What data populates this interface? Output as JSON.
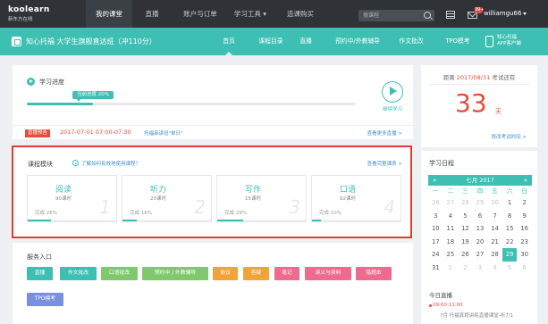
{
  "brand": {
    "name": "koolearn",
    "subtitle": "新东方在线"
  },
  "topnav": [
    {
      "label": "我的课堂",
      "active": true
    },
    {
      "label": "直播",
      "active": false
    },
    {
      "label": "账户与订单",
      "active": false
    },
    {
      "label": "学习工具 ▾",
      "active": false
    },
    {
      "label": "选课购买",
      "active": false
    }
  ],
  "search": {
    "placeholder": "搜课程"
  },
  "notifications": {
    "count": "99+"
  },
  "user": {
    "name": "williamgu66"
  },
  "course": {
    "title": "知心托福 大学生旗舰直达班（冲110分）"
  },
  "subnav": [
    {
      "label": "首页",
      "active": true
    },
    {
      "label": "课程目录",
      "active": false
    },
    {
      "label": "直播",
      "active": false
    },
    {
      "label": "预约中/外教辅导",
      "active": false
    },
    {
      "label": "作文批改",
      "active": false
    },
    {
      "label": "TPO模考",
      "active": false
    }
  ],
  "app": {
    "line1": "知心托福",
    "line2": "APP客户端"
  },
  "progress": {
    "title": "学习进度",
    "tag": "当前进度 20%",
    "percent": 20,
    "continue_label": "继续学习"
  },
  "live": {
    "badge": "直播预告",
    "time": "2017-07-01 07:00-07:30",
    "desc": "托福串讲班\"单日\"",
    "more": "查看更多直播 >"
  },
  "modules": {
    "title": "课程模块",
    "help": "了解如何有效地使用课程？",
    "more": "查看完整课表 >",
    "items": [
      {
        "name": "阅读",
        "hours": "90课时",
        "done": "完成 26%",
        "percent": 26,
        "num": "1"
      },
      {
        "name": "听力",
        "hours": "20课时",
        "done": "完成 16%",
        "percent": 16,
        "num": "2"
      },
      {
        "name": "写作",
        "hours": "15课时",
        "done": "完成 29%",
        "percent": 29,
        "num": "3"
      },
      {
        "name": "口语",
        "hours": "92课时",
        "done": "完成 10%",
        "percent": 10,
        "num": "4"
      }
    ]
  },
  "services": {
    "title": "服务入口",
    "items": [
      {
        "label": "直播",
        "color": "#3dbfb3"
      },
      {
        "label": "作文批改",
        "color": "#3dbfb3"
      },
      {
        "label": "口语批改",
        "color": "#7ec96b"
      },
      {
        "label": "预约中 / 外教辅导",
        "color": "#7ec96b"
      },
      {
        "label": "协议",
        "color": "#f3a23a"
      },
      {
        "label": "答疑",
        "color": "#f3a23a"
      },
      {
        "label": "笔记",
        "color": "#ee6b8f"
      },
      {
        "label": "讲义与资料",
        "color": "#ee6b8f"
      },
      {
        "label": "错题本",
        "color": "#ee6b8f"
      },
      {
        "label": "TPO模考",
        "color": "#7b8fe0"
      }
    ]
  },
  "countdown": {
    "prefix": "距离",
    "date": "2017/08/31",
    "suffix": "考试还有",
    "days": "33",
    "unit": "天",
    "edit": "修改考试时间 >"
  },
  "calendar": {
    "title": "学习日程",
    "month": "七月 2017",
    "prev": "«",
    "next": "»",
    "weekdays": [
      "一",
      "二",
      "三",
      "四",
      "五",
      "六",
      "日"
    ],
    "weeks": [
      [
        [
          "26",
          "other"
        ],
        [
          "27",
          "other"
        ],
        [
          "28",
          "other"
        ],
        [
          "29",
          "other"
        ],
        [
          "30",
          "other"
        ],
        [
          "1",
          ""
        ],
        [
          "2",
          ""
        ]
      ],
      [
        [
          "3",
          ""
        ],
        [
          "4",
          ""
        ],
        [
          "5",
          ""
        ],
        [
          "6",
          ""
        ],
        [
          "7",
          ""
        ],
        [
          "8",
          ""
        ],
        [
          "9",
          ""
        ]
      ],
      [
        [
          "10",
          ""
        ],
        [
          "11",
          ""
        ],
        [
          "12",
          ""
        ],
        [
          "13",
          ""
        ],
        [
          "14",
          ""
        ],
        [
          "15",
          ""
        ],
        [
          "16",
          ""
        ]
      ],
      [
        [
          "17",
          ""
        ],
        [
          "18",
          ""
        ],
        [
          "19",
          ""
        ],
        [
          "20",
          ""
        ],
        [
          "21",
          ""
        ],
        [
          "22",
          ""
        ],
        [
          "23",
          ""
        ]
      ],
      [
        [
          "24",
          ""
        ],
        [
          "25",
          ""
        ],
        [
          "26",
          ""
        ],
        [
          "27",
          ""
        ],
        [
          "28",
          ""
        ],
        [
          "29",
          "today"
        ],
        [
          "30",
          ""
        ]
      ],
      [
        [
          "31",
          ""
        ],
        [
          "1",
          "other"
        ],
        [
          "2",
          "other"
        ],
        [
          "3",
          "other"
        ],
        [
          "4",
          "other"
        ],
        [
          "5",
          "other"
        ],
        [
          "6",
          "other"
        ]
      ]
    ],
    "today_title": "今日直播",
    "event_time": "09:00-11:00",
    "event_desc": "7月 托福真题讲练直播课堂-听力1"
  }
}
